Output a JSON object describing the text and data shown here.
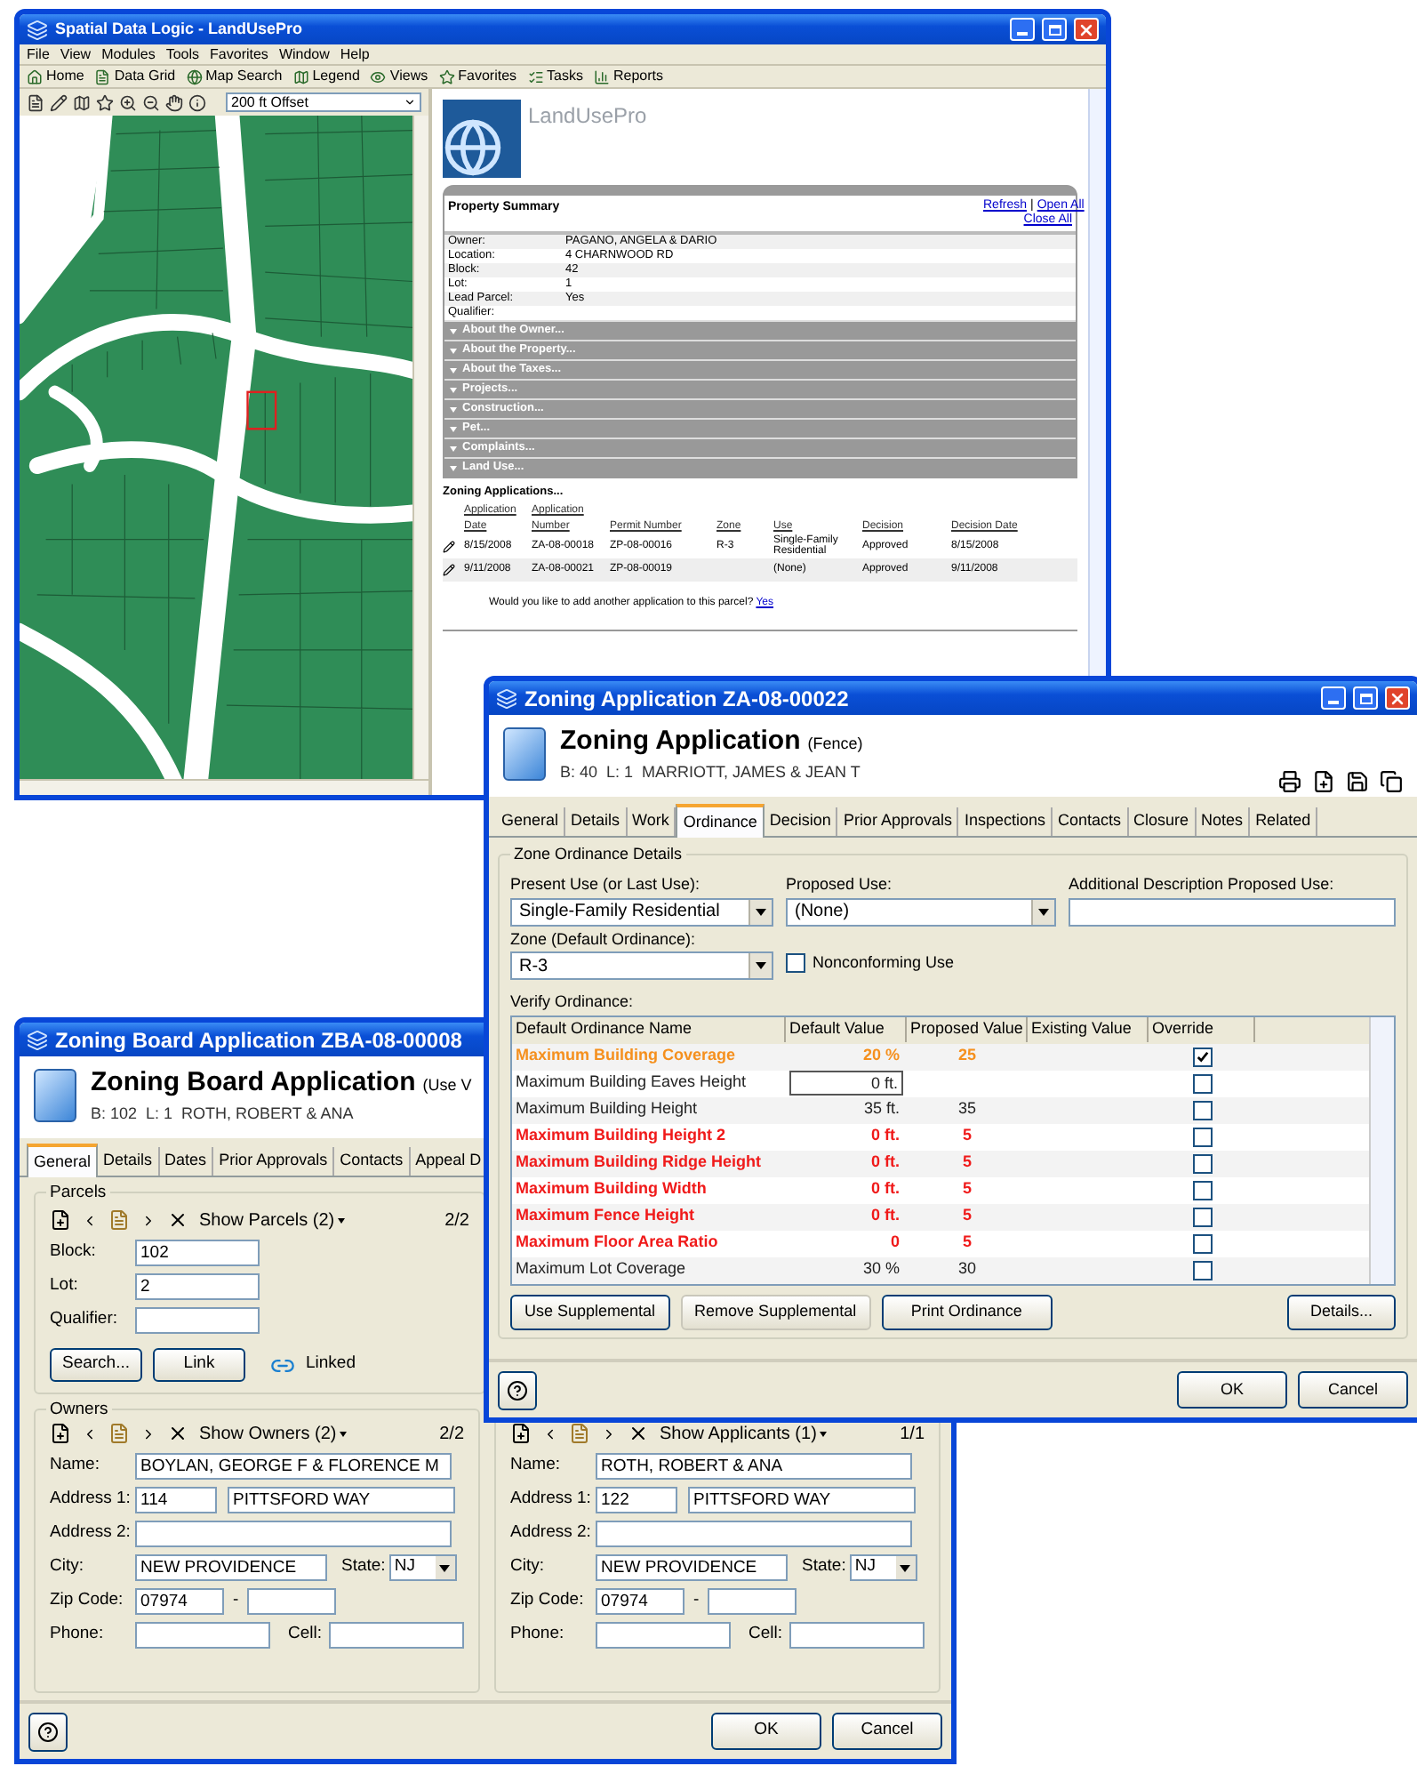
{
  "main_window": {
    "title": "Spatial Data Logic  - LandUsePro",
    "menu": [
      "File",
      "View",
      "Modules",
      "Tools",
      "Favorites",
      "Window",
      "Help"
    ],
    "toolbar": [
      "Home",
      "Data Grid",
      "Map Search",
      "Legend",
      "Views",
      "Favorites",
      "Tasks",
      "Reports"
    ],
    "map_offset": "200 ft Offset",
    "logo_text": "LandUsePro",
    "property_summary": {
      "title": "Property Summary",
      "links": [
        "Refresh",
        "Open All",
        "Close All"
      ],
      "link_separator": "|",
      "fields": [
        {
          "label": "Owner:",
          "value": "PAGANO, ANGELA & DARIO"
        },
        {
          "label": "Location:",
          "value": "4 CHARNWOOD RD"
        },
        {
          "label": "Block:",
          "value": "42"
        },
        {
          "label": "Lot:",
          "value": "1"
        },
        {
          "label": "Lead Parcel:",
          "value": "Yes"
        },
        {
          "label": "Qualifier:"
        }
      ],
      "sections": [
        "About the Owner...",
        "About the Property...",
        "About the Taxes...",
        "Projects...",
        "Construction...",
        "Pet...",
        "Complaints...",
        "Land Use..."
      ]
    },
    "zoning_applications": {
      "title": "Zoning Applications...",
      "columns": [
        "Application Date",
        "Application Number",
        "Permit Number",
        "Zone",
        "Use",
        "Decision",
        "Decision Date"
      ],
      "rows": [
        {
          "date": "8/15/2008",
          "number": "ZA-08-00018",
          "permit": "ZP-08-00016",
          "zone": "R-3",
          "use": "Single-Family Residential",
          "decision": "Approved",
          "decision_date": "8/15/2008"
        },
        {
          "date": "9/11/2008",
          "number": "ZA-08-00021",
          "permit": "ZP-08-00019",
          "use": "(None)",
          "decision": "Approved",
          "decision_date": "9/11/2008"
        }
      ],
      "prompt": "Would you like to add another application to this parcel?",
      "prompt_link": "Yes"
    }
  },
  "zoning_application_window": {
    "title": "Zoning Application ZA-08-00022",
    "heading": "Zoning Application",
    "subtype": "(Fence)",
    "subtitle": "B: 40  L: 1  MARRIOTT, JAMES & JEAN T",
    "tabs": [
      {
        "label": "General",
        "selected": false
      },
      {
        "label": "Details",
        "selected": false
      },
      {
        "label": "Work",
        "selected": false
      },
      {
        "label": "Ordinance",
        "selected": true
      },
      {
        "label": "Decision",
        "selected": false
      },
      {
        "label": "Prior Approvals",
        "selected": false
      },
      {
        "label": "Inspections",
        "selected": false
      },
      {
        "label": "Contacts",
        "selected": false
      },
      {
        "label": "Closure",
        "selected": false
      },
      {
        "label": "Notes",
        "selected": false
      },
      {
        "label": "Related",
        "selected": false
      }
    ],
    "group_title": "Zone Ordinance Details",
    "present_use": {
      "label": "Present Use (or Last Use):",
      "value": "Single-Family Residential"
    },
    "proposed_use": {
      "label": "Proposed Use:",
      "value": "(None)"
    },
    "additional_description": {
      "label": "Additional Description Proposed Use:"
    },
    "zone": {
      "label": "Zone (Default Ordinance):",
      "value": "R-3"
    },
    "nonconforming": {
      "label": "Nonconforming Use",
      "checked": false
    },
    "verify_label": "Verify Ordinance:",
    "ordinance": {
      "columns": [
        "Default Ordinance Name",
        "Default Value",
        "Proposed Value",
        "Existing Value",
        "Override"
      ],
      "rows": [
        {
          "name": "Maximum Building Coverage",
          "default": "20 %",
          "proposed": "25",
          "kind": "warning",
          "editing": false,
          "override": true
        },
        {
          "name": "Maximum Building Eaves Height",
          "default": "0 ft.",
          "kind": "normal",
          "editing": true,
          "override": false
        },
        {
          "name": "Maximum Building Height",
          "default": "35 ft.",
          "proposed": "35",
          "kind": "normal",
          "editing": false,
          "override": false
        },
        {
          "name": "Maximum Building Height 2",
          "default": "0 ft.",
          "proposed": "5",
          "kind": "violation",
          "editing": false,
          "override": false
        },
        {
          "name": "Maximum Building Ridge Height",
          "default": "0 ft.",
          "proposed": "5",
          "kind": "violation",
          "editing": false,
          "override": false
        },
        {
          "name": "Maximum Building Width",
          "default": "0 ft.",
          "proposed": "5",
          "kind": "violation",
          "editing": false,
          "override": false
        },
        {
          "name": "Maximum Fence Height",
          "default": "0 ft.",
          "proposed": "5",
          "kind": "violation",
          "editing": false,
          "override": false
        },
        {
          "name": "Maximum Floor Area Ratio",
          "default": "0",
          "proposed": "5",
          "kind": "violation",
          "editing": false,
          "override": false
        },
        {
          "name": "Maximum Lot Coverage",
          "default": "30 %",
          "proposed": "30",
          "kind": "normal",
          "editing": false,
          "override": false
        }
      ]
    },
    "buttons": [
      {
        "label": "Use Supplemental",
        "disabled": false
      },
      {
        "label": "Remove Supplemental",
        "disabled": true
      },
      {
        "label": "Print Ordinance",
        "disabled": false
      }
    ],
    "details_button": "Details...",
    "ok": "OK",
    "cancel": "Cancel"
  },
  "zoning_board_window": {
    "title": "Zoning Board Application ZBA-08-00008",
    "heading": "Zoning Board Application",
    "subtype": "(Use V",
    "subtitle": "B: 102  L: 1  ROTH, ROBERT & ANA",
    "tabs": [
      {
        "label": "General",
        "selected": true
      },
      {
        "label": "Details",
        "selected": false
      },
      {
        "label": "Dates",
        "selected": false
      },
      {
        "label": "Prior Approvals",
        "selected": false
      },
      {
        "label": "Contacts",
        "selected": false
      },
      {
        "label": "Appeal D",
        "selected": false
      }
    ],
    "parcels": {
      "title": "Parcels",
      "show": "Show Parcels (2)",
      "counter": "2/2",
      "fields": [
        {
          "label": "Block:",
          "value": "102"
        },
        {
          "label": "Lot:",
          "value": "2"
        },
        {
          "label": "Qualifier:"
        }
      ],
      "search": "Search...",
      "link": "Link",
      "linked": "Linked"
    },
    "owners": {
      "title": "Owners",
      "show": "Show Owners (2)",
      "counter": "2/2",
      "name": "BOYLAN, GEORGE F & FLORENCE M",
      "number": "114",
      "street": "PITTSFORD WAY",
      "city": "NEW PROVIDENCE",
      "state": "NJ",
      "zip": "07974",
      "labels": {
        "name": "Name:",
        "address1": "Address 1:",
        "address2": "Address 2:",
        "city": "City:",
        "state": "State:",
        "zip": "Zip Code:",
        "zip_separator": "-",
        "phone": "Phone:",
        "cell": "Cell:"
      }
    },
    "applicants": {
      "show": "Show Applicants (1)",
      "counter": "1/1",
      "name": "ROTH, ROBERT & ANA",
      "number": "122",
      "street": "PITTSFORD WAY",
      "city": "NEW PROVIDENCE",
      "state": "NJ",
      "zip": "07974",
      "labels": {
        "name": "Name:",
        "address1": "Address 1:",
        "address2": "Address 2:",
        "city": "City:",
        "state": "State:",
        "zip": "Zip Code:",
        "zip_separator": "-",
        "phone": "Phone:",
        "cell": "Cell:"
      }
    },
    "ok": "OK",
    "cancel": "Cancel"
  }
}
